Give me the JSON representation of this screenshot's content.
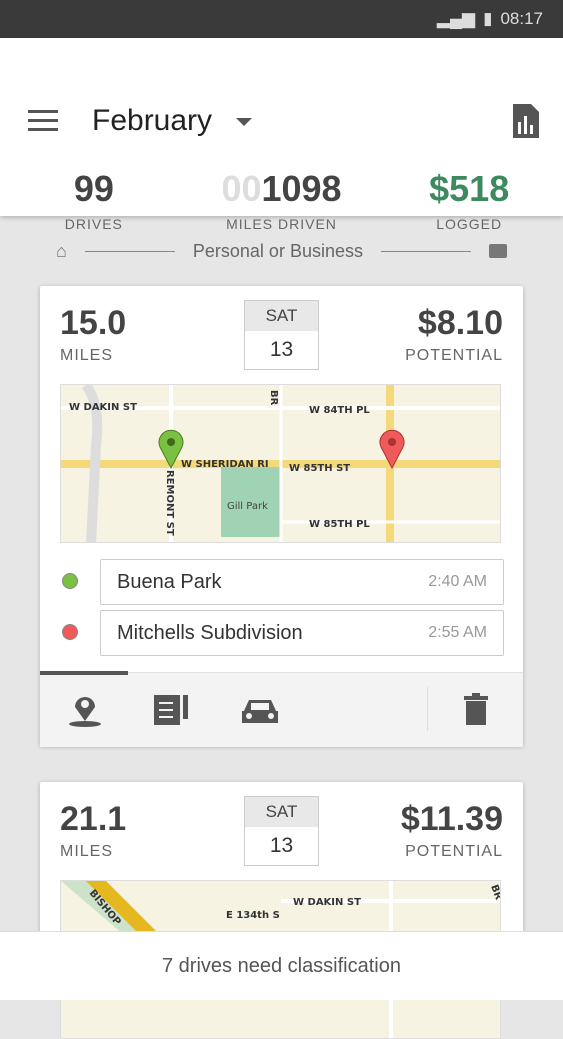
{
  "status": {
    "time": "08:17"
  },
  "header": {
    "month": "February",
    "stats": [
      {
        "value": "99",
        "label": "DRIVES"
      },
      {
        "value_dim": "00",
        "value": "1098",
        "label": "MILES DRIVEN"
      },
      {
        "value": "$518",
        "label": "LOGGED"
      }
    ]
  },
  "swipe": {
    "label": "Personal or Business"
  },
  "drives": [
    {
      "miles": "15.0",
      "miles_label": "MILES",
      "day": "SAT",
      "date": "13",
      "amount": "$8.10",
      "amount_label": "POTENTIAL",
      "streets": [
        "W DAKIN ST",
        "W 84TH PL",
        "W SHERIDAN RI",
        "W 85TH ST",
        "W 85TH PL",
        "REMONT ST",
        "Gill Park",
        "BR"
      ],
      "start": {
        "name": "Buena Park",
        "time": "2:40 AM"
      },
      "end": {
        "name": "Mitchells Subdivision",
        "time": "2:55 AM"
      }
    },
    {
      "miles": "21.1",
      "miles_label": "MILES",
      "day": "SAT",
      "date": "13",
      "amount": "$11.39",
      "amount_label": "POTENTIAL",
      "streets": [
        "BISHOP",
        "E 134th S",
        "W DAKIN ST",
        "BR"
      ]
    }
  ],
  "footer": {
    "message": "7 drives need classification"
  },
  "colors": {
    "green": "#3d8a5f",
    "start": "#7bc043",
    "end": "#f05a5a"
  }
}
